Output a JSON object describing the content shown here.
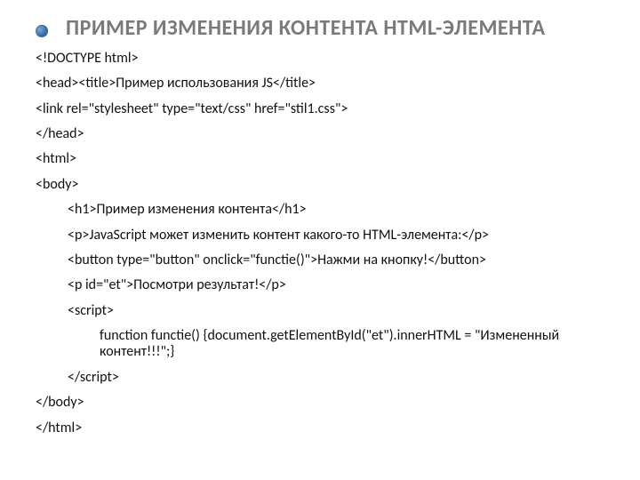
{
  "title": "ПРИМЕР ИЗМЕНЕНИЯ КОНТЕНТА HTML-ЭЛЕМЕНТА",
  "lines": {
    "l01": "<!DOCTYPE html>",
    "l02": "<head><title>Пример использования JS</title>",
    "l03": "<link rel=\"stylesheet\" type=\"text/css\" href=\"stil1.css\">",
    "l04": "</head>",
    "l05": "<html>",
    "l06": "<body>",
    "l07": "<h1>Пример изменения контента</h1>",
    "l08": "<p>JavaScript может изменить контент какого-то HTML-элемента:</p>",
    "l09": "<button type=\"button\" onclick=\"functie()\">Нажми на кнопку!</button>",
    "l10": "<p id=\"et\">Посмотри результат!</p>",
    "l11": "<script>",
    "l12": "function functie() {document.getElementById(\"et\").innerHTML = \"Измененный контент!!!\";}",
    "l13": "</script>",
    "l14": "</body>",
    "l15": "</html>"
  }
}
